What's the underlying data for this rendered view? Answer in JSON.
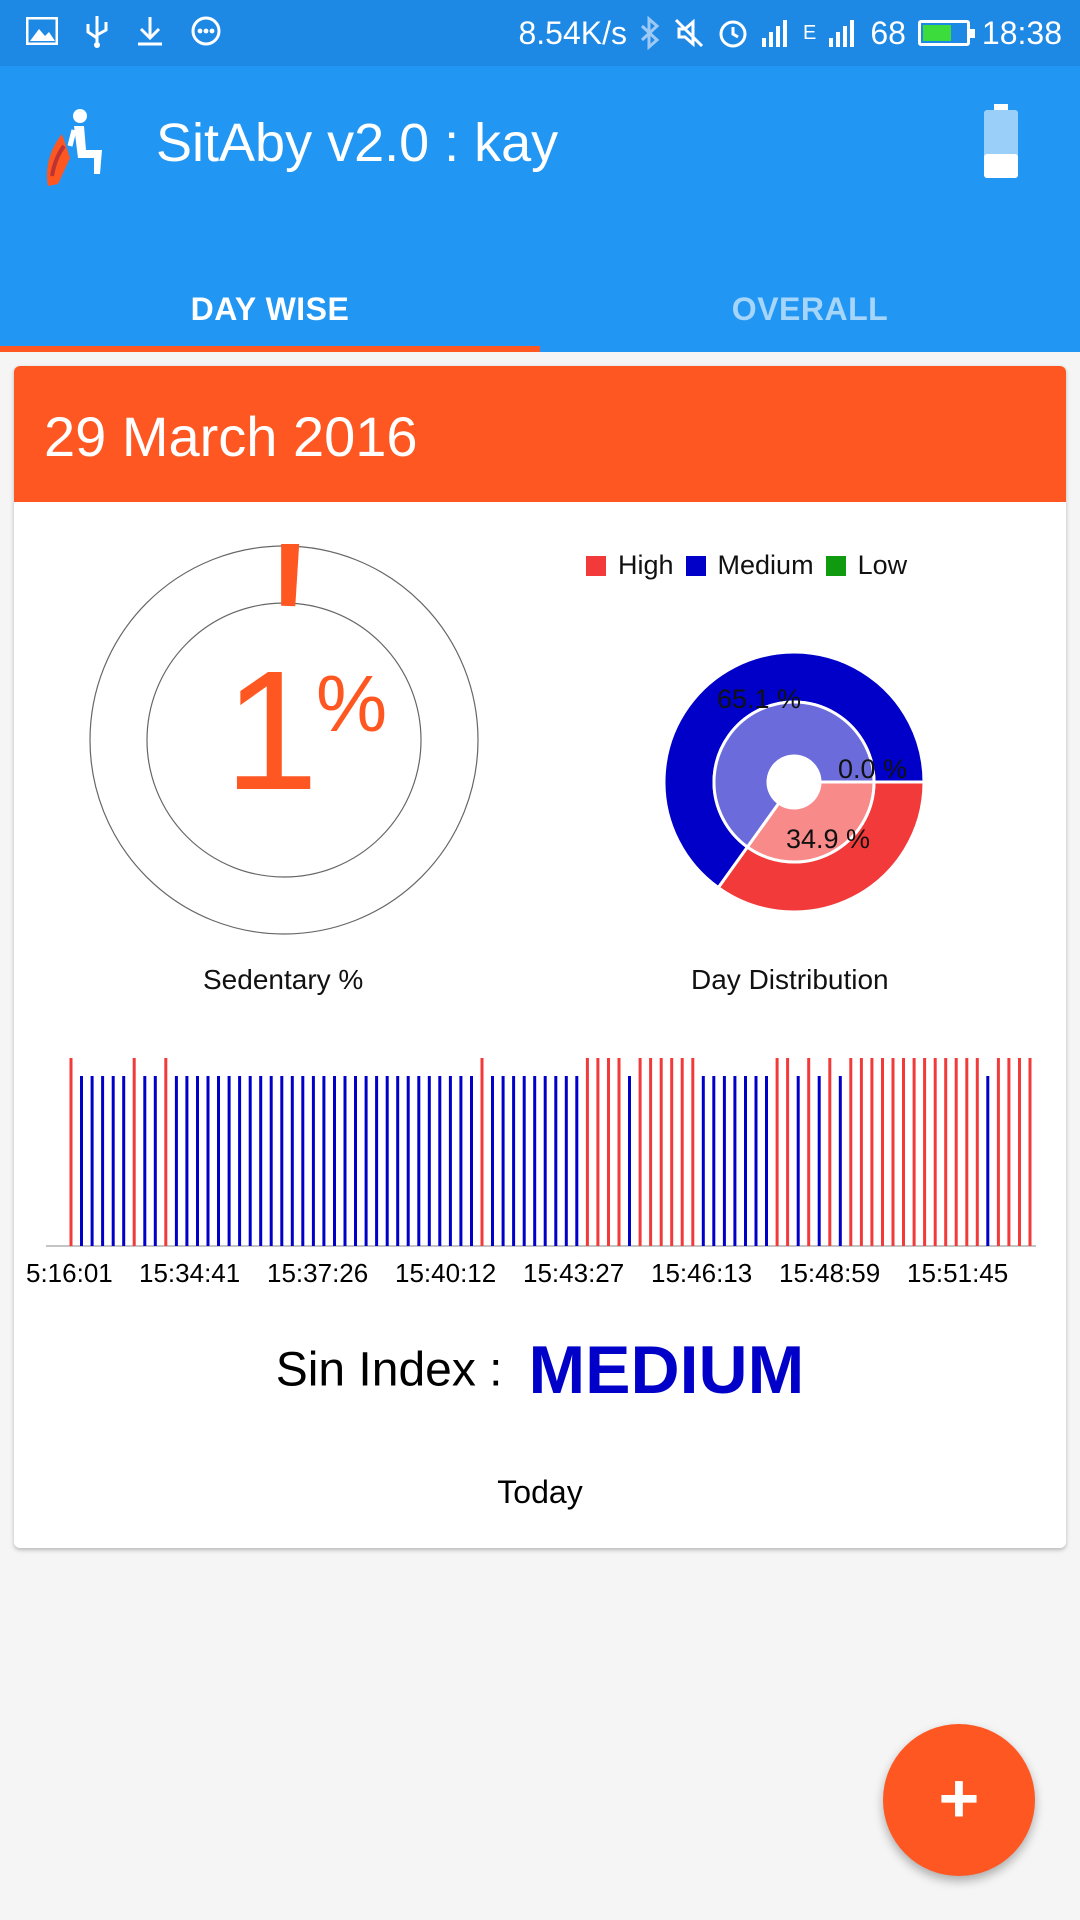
{
  "status_bar": {
    "left_icons": [
      "image-icon",
      "usb-icon",
      "download-icon",
      "more-circle-icon"
    ],
    "net_speed": "8.54K/s",
    "network_type": "E",
    "battery_level": "68",
    "time": "18:38",
    "right_icons": [
      "bluetooth-icon",
      "mute-icon",
      "alarm-icon",
      "signal-icon",
      "battery-icon"
    ]
  },
  "app_bar": {
    "title": "SitAby v2.0 : kay",
    "logo_icon": "sitting-person-logo-icon",
    "action_icon": "battery-icon"
  },
  "tabs": [
    {
      "label": "DAY WISE",
      "active": true
    },
    {
      "label": "OVERALL",
      "active": false
    }
  ],
  "card": {
    "date": "29 March 2016",
    "sedentary": {
      "value": "1",
      "unit": "%",
      "caption": "Sedentary %",
      "fraction": 0.01
    },
    "distribution_caption": "Day Distribution",
    "sin_index_label": "Sin Index :",
    "sin_index_value": "MEDIUM",
    "footer": "Today"
  },
  "colors": {
    "primary": "#2196f3",
    "status_bar": "#1e88e5",
    "accent": "#ff5722",
    "high": "#f23a3a",
    "medium": "#0000c8",
    "low": "#109a10"
  },
  "fab": {
    "label": "+"
  },
  "chart_data": [
    {
      "type": "pie",
      "legend": [
        "High",
        "Medium",
        "Low"
      ],
      "legend_position": "top",
      "values": [
        34.9,
        65.1,
        0.0
      ],
      "labels": [
        "34.9 %",
        "65.1 %",
        "0.0 %"
      ]
    },
    {
      "type": "bar",
      "x_tick_labels": [
        "5:16:01",
        "15:34:41",
        "15:37:26",
        "15:40:12",
        "15:43:27",
        "15:46:13",
        "15:48:59",
        "15:51:45"
      ],
      "series": [
        {
          "name": "High",
          "values": [
            1,
            0,
            0,
            0,
            0,
            0,
            1,
            0,
            0,
            1,
            0,
            0,
            0,
            0,
            0,
            0,
            0,
            0,
            0,
            0,
            0,
            0,
            0,
            0,
            0,
            0,
            0,
            0,
            0,
            0,
            0,
            0,
            0,
            0,
            0,
            0,
            0,
            0,
            0,
            1,
            0,
            0,
            0,
            0,
            0,
            0,
            0,
            0,
            0,
            1,
            1,
            1,
            1,
            0,
            1,
            1,
            1,
            1,
            1,
            1,
            0,
            0,
            0,
            0,
            0,
            0,
            0,
            1,
            1,
            0,
            1,
            0,
            1,
            0,
            1,
            1,
            1,
            1,
            1,
            1,
            1,
            1,
            1,
            1,
            1,
            1,
            1,
            0,
            1,
            1,
            1,
            1
          ]
        },
        {
          "name": "Medium",
          "values": [
            0,
            1,
            1,
            1,
            1,
            1,
            0,
            1,
            1,
            0,
            1,
            1,
            1,
            1,
            1,
            1,
            1,
            1,
            1,
            1,
            1,
            1,
            1,
            1,
            1,
            1,
            1,
            1,
            1,
            1,
            1,
            1,
            1,
            1,
            1,
            1,
            1,
            1,
            1,
            0,
            1,
            1,
            1,
            1,
            1,
            1,
            1,
            1,
            1,
            0,
            0,
            0,
            0,
            1,
            0,
            0,
            0,
            0,
            0,
            0,
            1,
            1,
            1,
            1,
            1,
            1,
            1,
            0,
            0,
            1,
            0,
            1,
            0,
            1,
            0,
            0,
            0,
            0,
            0,
            0,
            0,
            0,
            0,
            0,
            0,
            0,
            0,
            1,
            0,
            0,
            0,
            0
          ]
        }
      ]
    }
  ]
}
